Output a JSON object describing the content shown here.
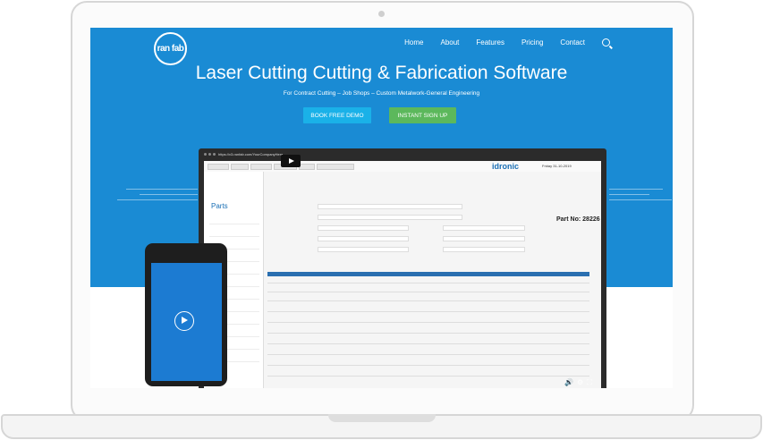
{
  "brand": {
    "logo_text": "ran fab"
  },
  "nav": {
    "items": [
      "Home",
      "About",
      "Features",
      "Pricing",
      "Contact"
    ]
  },
  "hero": {
    "title": "Laser Cutting Cutting & Fabrication Software",
    "subtitle": "For Contract Cutting – Job Shops – Custom Metalwork-General Engineering",
    "demo_button": "BOOK FREE DEMO",
    "signup_button": "INSTANT SIGN UP"
  },
  "browser": {
    "url": "https://v3.ranfab.com/YourCompanyHere"
  },
  "app": {
    "brand": "idronic",
    "date": "Friday 31-10-2019",
    "sidebar_title": "Parts",
    "part_number": "Part No: 28226"
  },
  "colors": {
    "hero_bg": "#1a8bd4",
    "demo_btn": "#1ab1e8",
    "signup_btn": "#5cb85c"
  }
}
